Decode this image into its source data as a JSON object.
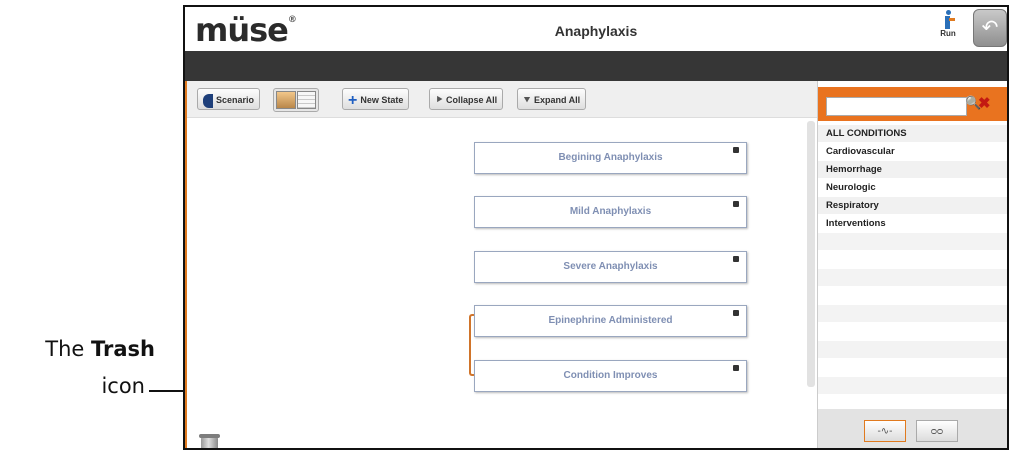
{
  "callout": {
    "text_prefix": "The ",
    "text_bold": "Trash",
    "text_line2": "icon"
  },
  "header": {
    "logo": "müse",
    "logo_mark": "®",
    "title": "Anaphylaxis",
    "run_label": "Run",
    "back_glyph": "↶"
  },
  "toolbar": {
    "scenario_label": "Scenario",
    "new_state_label": "New State",
    "collapse_all_label": "Collapse All",
    "expand_all_label": "Expand All"
  },
  "states": [
    {
      "label": "Begining Anaphylaxis"
    },
    {
      "label": "Mild Anaphylaxis"
    },
    {
      "label": "Severe Anaphylaxis"
    },
    {
      "label": "Epinephrine Administered"
    },
    {
      "label": "Condition Improves"
    }
  ],
  "sidebar": {
    "search_placeholder": "",
    "search_icon": "🔍",
    "clear_icon": "✖",
    "categories": [
      "ALL CONDITIONS",
      "Cardiovascular",
      "Hemorrhage",
      "Neurologic",
      "Respiratory",
      "Interventions"
    ],
    "tabs": [
      {
        "glyph": "-∿-",
        "icon": "waveform-icon"
      },
      {
        "glyph": "ᴑᴑ",
        "icon": "voicemail-icon"
      }
    ]
  },
  "colors": {
    "accent": "#e9731f",
    "dark_bar": "#363636",
    "state_text": "#7f8fb3"
  }
}
